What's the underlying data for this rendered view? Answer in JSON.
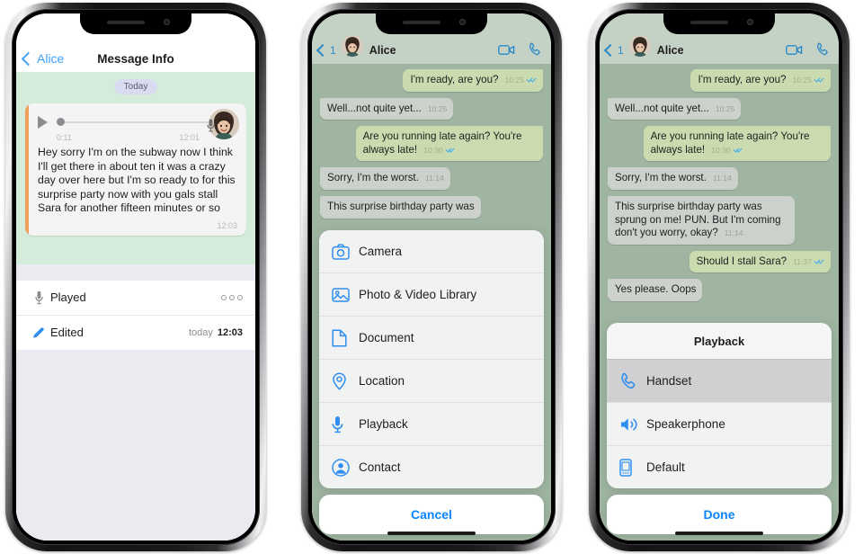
{
  "phone1": {
    "navbar": {
      "back_label": "Alice",
      "title": "Message Info"
    },
    "day_pill": "Today",
    "voice_message": {
      "elapsed": "0:11",
      "duration": "12:01",
      "transcript": "Hey sorry I'm on the subway now I think I'll get there in about ten it was a crazy day over here but I'm so ready to for this surprise party now with you gals stall Sara for another fifteen minutes or so",
      "timestamp": "12:03"
    },
    "info_rows": [
      {
        "icon": "microphone-icon",
        "label": "Played",
        "value": "",
        "value_bold": "",
        "trailing": "ellipsis"
      },
      {
        "icon": "pencil-icon",
        "label": "Edited",
        "value": "today",
        "value_bold": "12:03",
        "trailing": "text"
      }
    ]
  },
  "phone2": {
    "navbar": {
      "back_count": "1",
      "name": "Alice",
      "video_icon": "video-camera-icon",
      "call_icon": "phone-icon"
    },
    "messages": [
      {
        "dir": "out",
        "text": "I'm ready, are you?",
        "time": "10:25",
        "ticks": true
      },
      {
        "dir": "in",
        "text": "Well...not quite yet...",
        "time": "10:25",
        "ticks": false
      },
      {
        "dir": "out",
        "text": "Are you running late again? You're always late!",
        "time": "10:30",
        "ticks": true
      },
      {
        "dir": "in",
        "text": "Sorry, I'm the worst.",
        "time": "11:14",
        "ticks": false
      },
      {
        "dir": "in",
        "text": "This surprise birthday party was",
        "time": "",
        "ticks": false
      }
    ],
    "sheet": {
      "title": "",
      "items": [
        {
          "icon": "camera-icon",
          "label": "Camera"
        },
        {
          "icon": "photo-library-icon",
          "label": "Photo & Video Library"
        },
        {
          "icon": "document-icon",
          "label": "Document"
        },
        {
          "icon": "location-pin-icon",
          "label": "Location"
        },
        {
          "icon": "microphone-icon",
          "label": "Playback"
        },
        {
          "icon": "contact-icon",
          "label": "Contact"
        }
      ],
      "button_label": "Cancel"
    }
  },
  "phone3": {
    "navbar": {
      "back_count": "1",
      "name": "Alice",
      "video_icon": "video-camera-icon",
      "call_icon": "phone-icon"
    },
    "messages": [
      {
        "dir": "out",
        "text": "I'm ready, are you?",
        "time": "10:25",
        "ticks": true
      },
      {
        "dir": "in",
        "text": "Well...not quite yet...",
        "time": "10:25",
        "ticks": false
      },
      {
        "dir": "out",
        "text": "Are you running late again? You're always late!",
        "time": "10:30",
        "ticks": true
      },
      {
        "dir": "in",
        "text": "Sorry, I'm the worst.",
        "time": "11:14",
        "ticks": false
      },
      {
        "dir": "in",
        "text": "This surprise birthday party was sprung on me! PUN. But I'm coming don't you worry, okay?",
        "time": "11:14",
        "ticks": false
      },
      {
        "dir": "out",
        "text": "Should I stall Sara?",
        "time": "11:37",
        "ticks": true
      },
      {
        "dir": "in",
        "text": "Yes please. Oops",
        "time": "",
        "ticks": false
      }
    ],
    "sheet": {
      "title": "Playback",
      "items": [
        {
          "icon": "handset-icon",
          "label": "Handset",
          "selected": true
        },
        {
          "icon": "speaker-icon",
          "label": "Speakerphone",
          "selected": false
        },
        {
          "icon": "mobile-device-icon",
          "label": "Default",
          "selected": false
        }
      ],
      "button_label": "Done"
    }
  },
  "colors": {
    "accent_blue": "#0b84fe",
    "nav_link_blue": "#3fa2f7",
    "outgoing_bubble": "#cadcaf",
    "incoming_bubble": "#ccd2cb",
    "chat_background": "#9fb4a1",
    "info_chat_background": "#d4ecd9",
    "voice_accent": "#f0a05a",
    "tick_blue": "#3fa9f5"
  }
}
